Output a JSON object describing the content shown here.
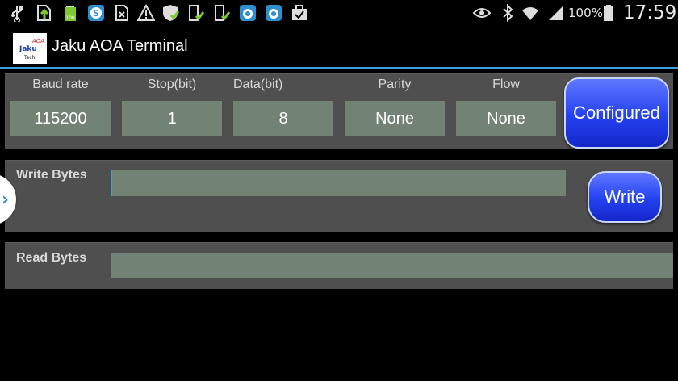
{
  "status_bar": {
    "notification_icons": [
      "usb-icon",
      "upload-icon",
      "battery-full-icon",
      "skype-icon",
      "sd-card-icon",
      "warning-icon",
      "shield-check-icon",
      "clipboard-check-icon",
      "clipboard-check-icon",
      "app-icon",
      "app-icon",
      "briefcase-check-icon"
    ],
    "battery_percent": "100%",
    "time": "17:59"
  },
  "action_bar": {
    "logo_text_top": "AOA",
    "logo_text_mid": "Jaku",
    "logo_text_bottom": "Tech",
    "title": "Jaku AOA Terminal"
  },
  "config": {
    "columns": [
      {
        "label": "Baud rate",
        "value": "115200"
      },
      {
        "label": "Stop(bit)",
        "value": "1"
      },
      {
        "label": "Data(bit)",
        "value": "8"
      },
      {
        "label": "Parity",
        "value": "None"
      },
      {
        "label": "Flow",
        "value": "None"
      }
    ],
    "configure_label": "Configured"
  },
  "write": {
    "label": "Write Bytes",
    "value": "",
    "button_label": "Write"
  },
  "read": {
    "label": "Read Bytes",
    "value": ""
  },
  "colors": {
    "accent": "#3aa3d4",
    "panel": "#4f4f4f",
    "field": "#728375",
    "button_blue": "#2441f0"
  }
}
